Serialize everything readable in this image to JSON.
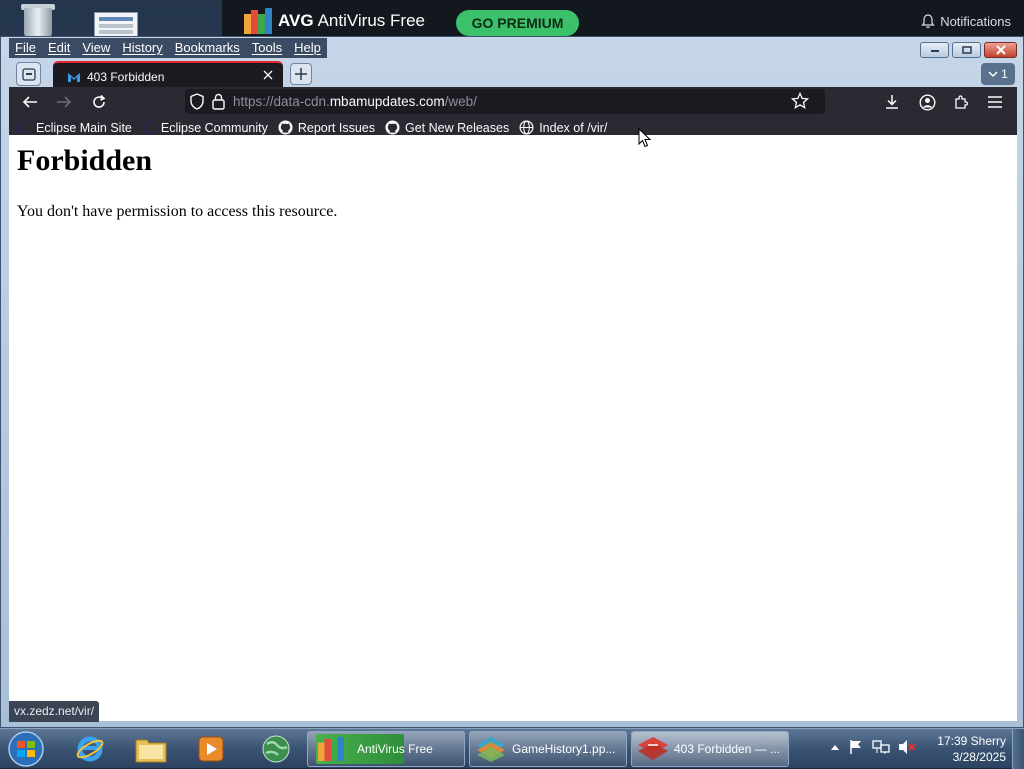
{
  "desktop": {
    "icons": [
      "recycle-bin-icon",
      "document-icon"
    ]
  },
  "avg": {
    "brand": "AVG",
    "product": "AntiVirus Free",
    "premium_button": "GO PREMIUM",
    "notifications": "Notifications"
  },
  "firefox": {
    "menu": [
      "File",
      "Edit",
      "View",
      "History",
      "Bookmarks",
      "Tools",
      "Help"
    ],
    "tab": {
      "title": "403 Forbidden",
      "count": "1"
    },
    "url": {
      "scheme_prefix": "https://data-cdn.",
      "host": "mbamupdates.com",
      "path": "/web/"
    },
    "bookmarks": [
      {
        "label": "Eclipse Main Site",
        "icon": "eclipse-icon"
      },
      {
        "label": "Eclipse Community",
        "icon": "eclipse-icon"
      },
      {
        "label": "Report Issues",
        "icon": "github-icon"
      },
      {
        "label": "Get New Releases",
        "icon": "github-icon"
      },
      {
        "label": "Index of /vir/",
        "icon": "globe-icon"
      }
    ],
    "page": {
      "heading": "Forbidden",
      "message": "You don't have permission to access this resource."
    },
    "status_link": "vx.zedz.net/vir/"
  },
  "taskbar": {
    "tasks": [
      {
        "label": "AntiVirus Free",
        "icon": "avg-icon"
      },
      {
        "label": "GameHistory1.pp...",
        "icon": "powerpoint-icon"
      },
      {
        "label": "403 Forbidden — ...",
        "icon": "firefox-icon"
      }
    ],
    "clock": {
      "time": "17:39",
      "user": "Sherry",
      "date": "3/28/2025"
    }
  },
  "colors": {
    "avg_green": "#3ac16a",
    "firefox_toolbar": "#2b2a33",
    "firefox_urlbar": "#1c1b22",
    "tab_accent": "#e0282e"
  }
}
